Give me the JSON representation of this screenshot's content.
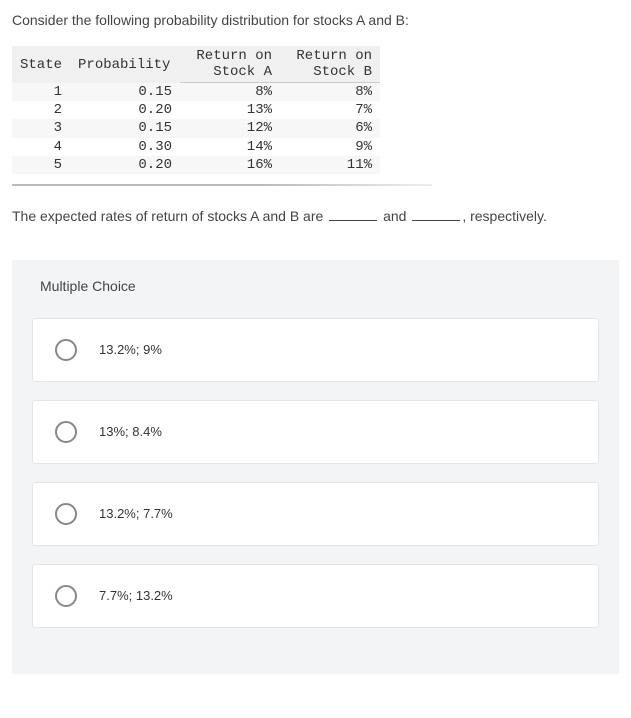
{
  "question_text": "Consider the following probability distribution for stocks A and B:",
  "table": {
    "headers": {
      "state": "State",
      "probability": "Probability",
      "return_on": "Return on",
      "stock_a": "Stock A",
      "stock_b": "Stock B"
    },
    "rows": [
      {
        "state": "1",
        "prob": "0.15",
        "a": "8%",
        "b": "8%"
      },
      {
        "state": "2",
        "prob": "0.20",
        "a": "13%",
        "b": "7%"
      },
      {
        "state": "3",
        "prob": "0.15",
        "a": "12%",
        "b": "6%"
      },
      {
        "state": "4",
        "prob": "0.30",
        "a": "14%",
        "b": "9%"
      },
      {
        "state": "5",
        "prob": "0.20",
        "a": "16%",
        "b": "11%"
      }
    ]
  },
  "fill_in": {
    "pre": "The expected rates of return of stocks A and B are ",
    "mid": " and ",
    "post": ", respectively."
  },
  "mc_title": "Multiple Choice",
  "choices": [
    {
      "label": "13.2%; 9%"
    },
    {
      "label": "13%; 8.4%"
    },
    {
      "label": "13.2%; 7.7%"
    },
    {
      "label": "7.7%; 13.2%"
    }
  ]
}
